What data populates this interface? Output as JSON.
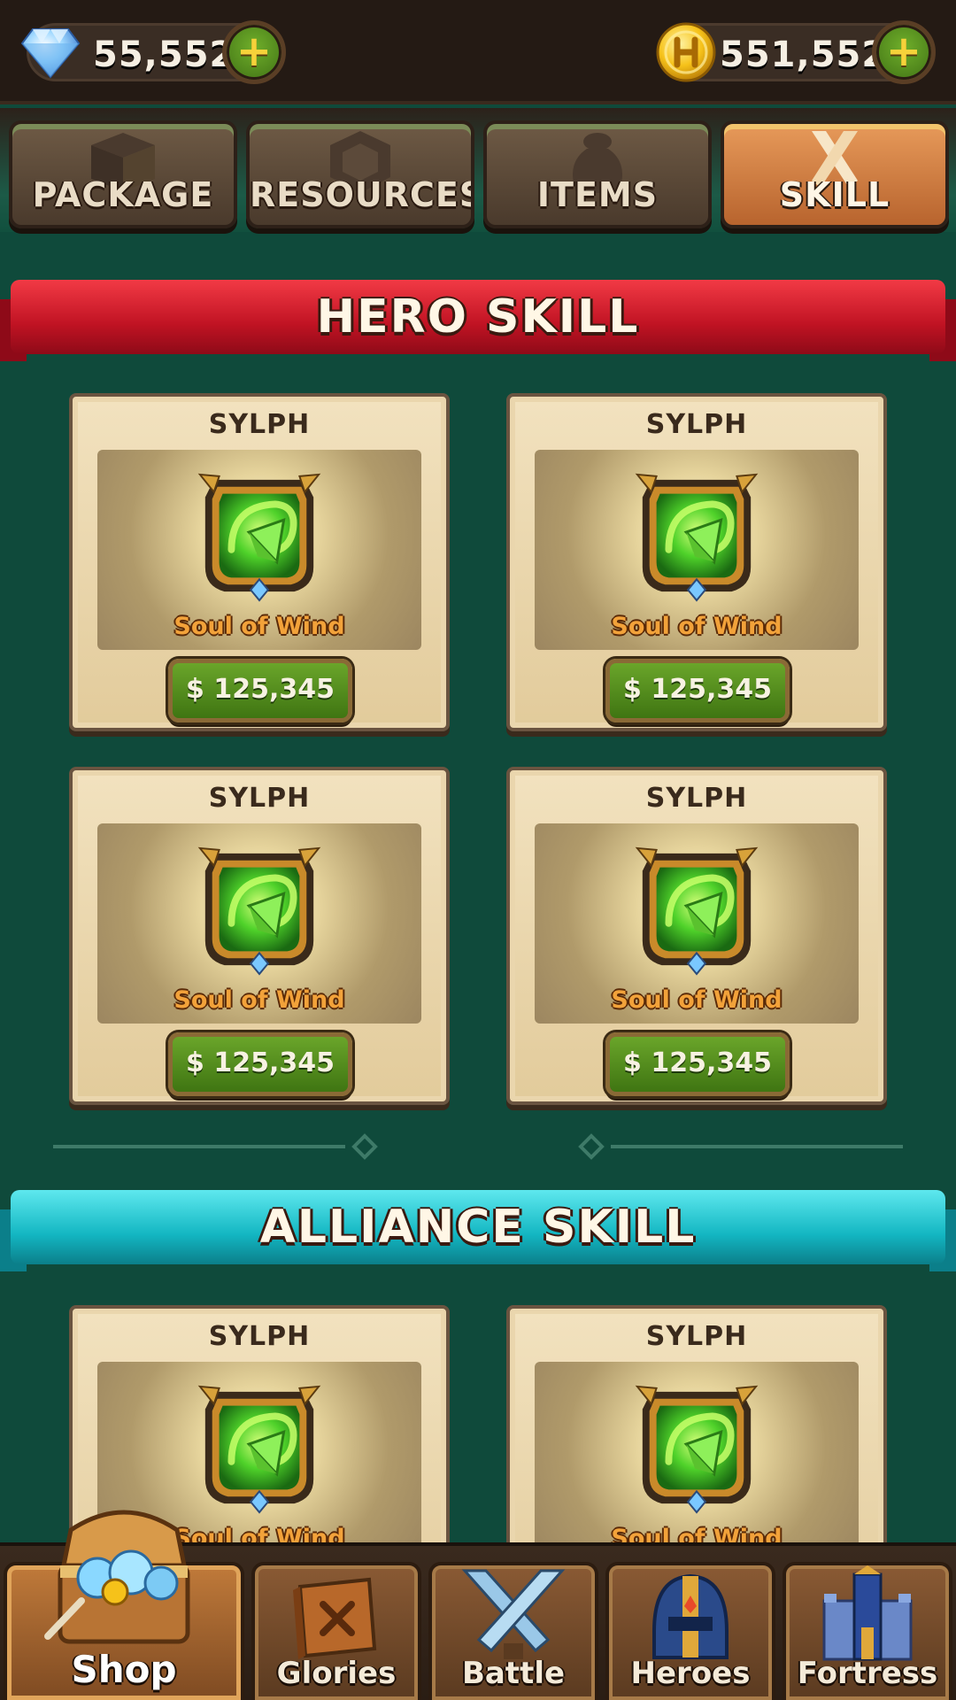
{
  "currencies": {
    "gems": "55,552",
    "gold": "551,552"
  },
  "tabs": [
    {
      "label": "PACKAGE",
      "icon": "box-icon",
      "active": false
    },
    {
      "label": "RESOURCES",
      "icon": "gem-outline-icon",
      "active": false
    },
    {
      "label": "ITEMS",
      "icon": "bag-icon",
      "active": false
    },
    {
      "label": "SKILL",
      "icon": "crossed-swords-icon",
      "active": true
    }
  ],
  "sections": {
    "hero": {
      "title": "HERO SKILL",
      "cards": [
        {
          "hero": "SYLPH",
          "skill": "Soul of Wind",
          "price": "$ 125,345"
        },
        {
          "hero": "SYLPH",
          "skill": "Soul of Wind",
          "price": "$ 125,345"
        },
        {
          "hero": "SYLPH",
          "skill": "Soul of Wind",
          "price": "$ 125,345"
        },
        {
          "hero": "SYLPH",
          "skill": "Soul of Wind",
          "price": "$ 125,345"
        }
      ]
    },
    "alliance": {
      "title": "ALLIANCE SKILL",
      "cards": [
        {
          "hero": "SYLPH",
          "skill": "Soul of Wind"
        },
        {
          "hero": "SYLPH",
          "skill": "Soul of Wind"
        }
      ]
    }
  },
  "nav": [
    {
      "label": "Shop",
      "icon": "treasure-chest-icon",
      "active": true
    },
    {
      "label": "Glories",
      "icon": "book-icon",
      "active": false
    },
    {
      "label": "Battle",
      "icon": "crossed-swords-icon",
      "active": false
    },
    {
      "label": "Heroes",
      "icon": "helmet-icon",
      "active": false
    },
    {
      "label": "Fortress",
      "icon": "fortress-icon",
      "active": false
    }
  ],
  "colors": {
    "background": "#0f4a3b",
    "hero_banner": "#c01323",
    "alliance_banner": "#13b6c2",
    "price_button": "#4f8a1c",
    "skill_text": "#f2a23a",
    "active_tab": "#d4824a"
  }
}
